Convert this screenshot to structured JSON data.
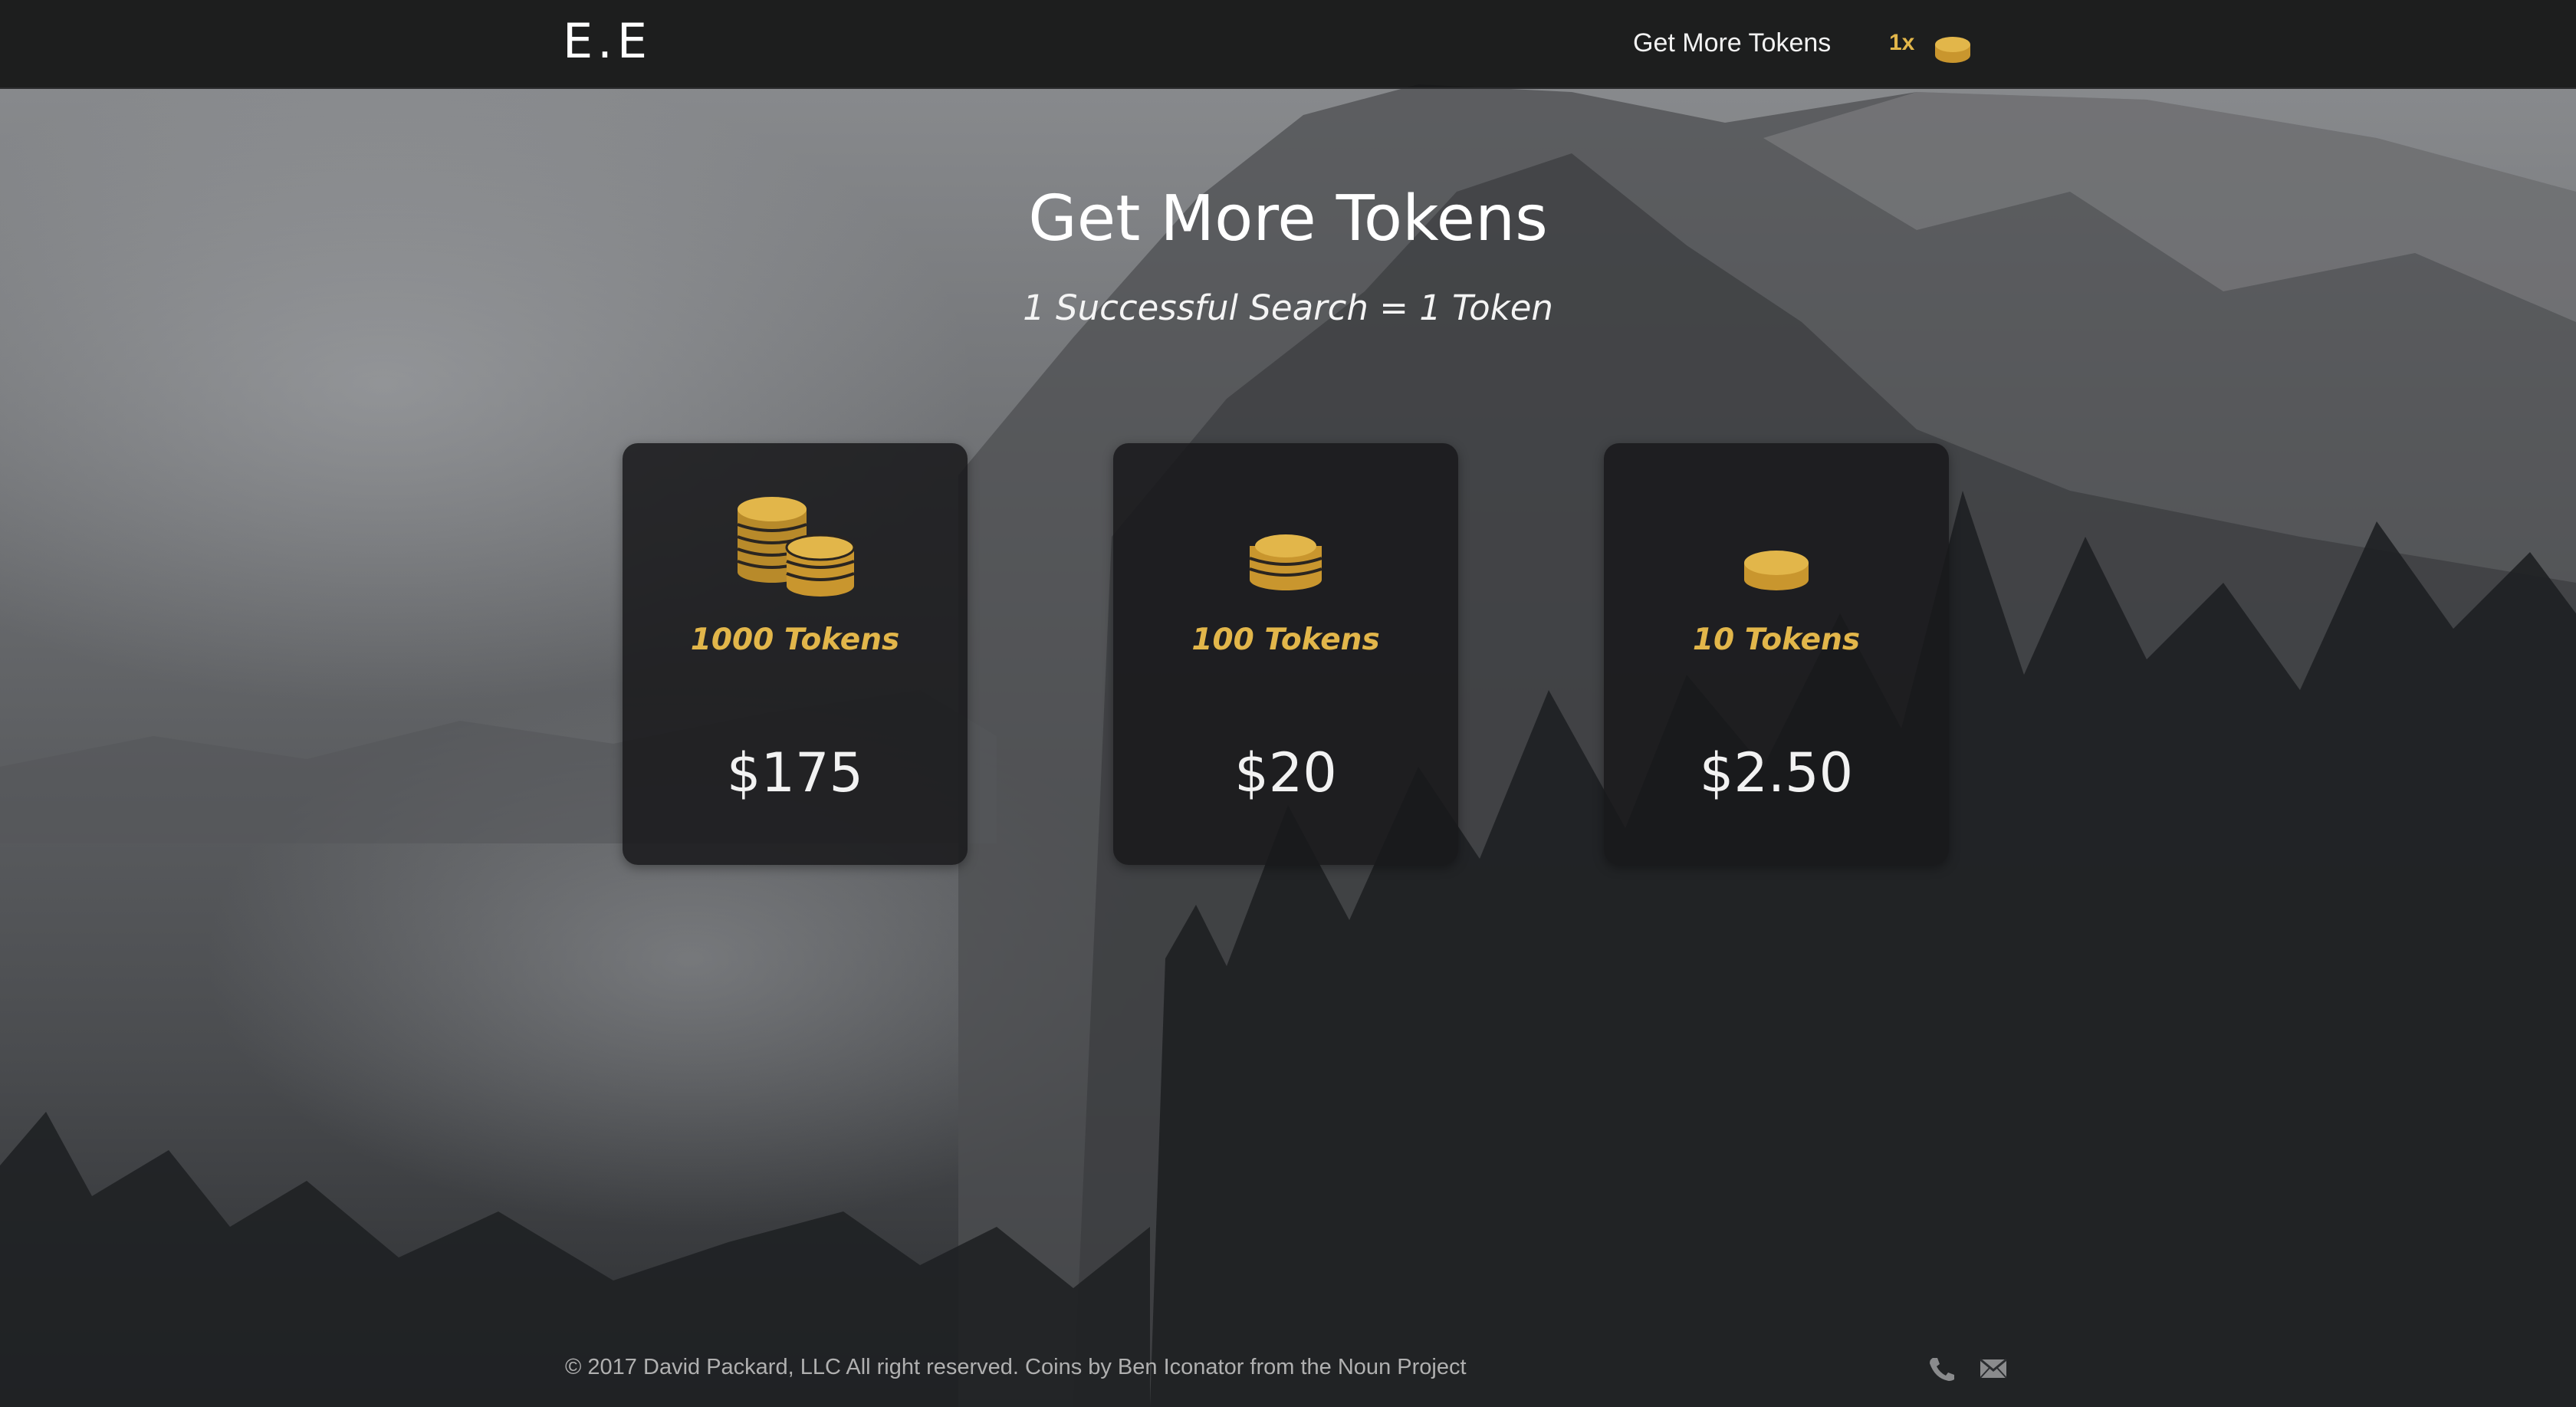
{
  "nav": {
    "brand": "E.E",
    "link": "Get More Tokens",
    "token_count": "1x",
    "coin_icon": "coin-icon"
  },
  "header": {
    "title": "Get More Tokens",
    "subtitle": "1 Successful Search = 1 Token"
  },
  "packages": [
    {
      "name": "1000 Tokens",
      "price": "$175",
      "icon": "coin-stacks-icon"
    },
    {
      "name": "100 Tokens",
      "price": "$20",
      "icon": "coin-stack-icon"
    },
    {
      "name": "10 Tokens",
      "price": "$2.50",
      "icon": "coin-icon"
    }
  ],
  "footer": {
    "text": "© 2017 David Packard, LLC All right reserved. Coins by Ben Iconator from the Noun Project",
    "icons": [
      "phone-icon",
      "mail-icon"
    ]
  },
  "colors": {
    "accent_gold": "#e2b64a",
    "navbar": "#141516",
    "card_bg": "#18191b"
  }
}
